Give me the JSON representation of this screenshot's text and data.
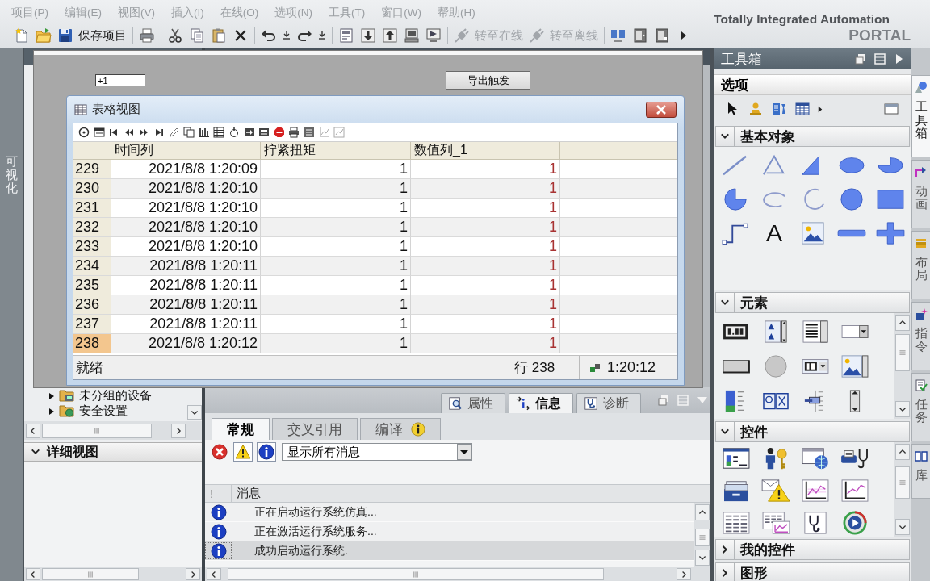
{
  "menu_bar": {
    "items": [
      {
        "label": "项目(P)",
        "disabled": true
      },
      {
        "label": "编辑(E)",
        "disabled": true
      },
      {
        "label": "视图(V)",
        "disabled": true
      },
      {
        "label": "插入(I)",
        "disabled": true
      },
      {
        "label": "在线(O)",
        "disabled": true
      },
      {
        "label": "选项(N)",
        "disabled": true
      },
      {
        "label": "工具(T)",
        "disabled": true
      },
      {
        "label": "窗口(W)",
        "disabled": true
      },
      {
        "label": "帮助(H)",
        "disabled": true
      }
    ]
  },
  "toolbar": {
    "buttons": [
      {
        "label": "保存项目",
        "disabled": false
      },
      {
        "label": "转至在线",
        "disabled": true
      },
      {
        "label": "转至离线",
        "disabled": true
      }
    ]
  },
  "branding": {
    "title": "Totally Integrated Automation",
    "product": "PORTAL"
  },
  "side_strip": {
    "label": "可视化"
  },
  "project_tree": {
    "items": [
      {
        "label": "未分组的设备",
        "expanded": false
      },
      {
        "label": "安全设置",
        "expanded": false
      }
    ],
    "detail_view": {
      "title": "详细视图",
      "expanded": true
    }
  },
  "runtime_screen": {
    "io_field": {
      "value": "+1"
    },
    "export_button": {
      "label": "导出触发"
    },
    "table_view": {
      "title": "表格视图",
      "columns": [
        "时间列",
        "拧紧扭矩",
        "数值列_1"
      ],
      "rows": [
        {
          "number": "229",
          "time": "2021/8/8 1:20:09",
          "torque": "1",
          "value": "1",
          "selected": false
        },
        {
          "number": "230",
          "time": "2021/8/8 1:20:10",
          "torque": "1",
          "value": "1",
          "selected": false
        },
        {
          "number": "231",
          "time": "2021/8/8 1:20:10",
          "torque": "1",
          "value": "1",
          "selected": false
        },
        {
          "number": "232",
          "time": "2021/8/8 1:20:10",
          "torque": "1",
          "value": "1",
          "selected": false
        },
        {
          "number": "233",
          "time": "2021/8/8 1:20:10",
          "torque": "1",
          "value": "1",
          "selected": false
        },
        {
          "number": "234",
          "time": "2021/8/8 1:20:11",
          "torque": "1",
          "value": "1",
          "selected": false
        },
        {
          "number": "235",
          "time": "2021/8/8 1:20:11",
          "torque": "1",
          "value": "1",
          "selected": false
        },
        {
          "number": "236",
          "time": "2021/8/8 1:20:11",
          "torque": "1",
          "value": "1",
          "selected": false
        },
        {
          "number": "237",
          "time": "2021/8/8 1:20:11",
          "torque": "1",
          "value": "1",
          "selected": false
        },
        {
          "number": "238",
          "time": "2021/8/8 1:20:12",
          "torque": "1",
          "value": "1",
          "selected": true
        }
      ],
      "status": "就绪",
      "row_indicator": "行 238",
      "time": "1:20:12"
    }
  },
  "inspector": {
    "tabs": [
      {
        "label": "属性",
        "selected": false
      },
      {
        "label": "信息",
        "selected": true
      },
      {
        "label": "诊断",
        "selected": false
      }
    ],
    "subtabs": [
      {
        "label": "常规",
        "selected": true
      },
      {
        "label": "交叉引用",
        "selected": false
      },
      {
        "label": "编译",
        "selected": false,
        "badge": {
          "kind": "info"
        }
      }
    ],
    "filters": [
      {
        "kind": "error",
        "on": false
      },
      {
        "kind": "warning",
        "on": true
      },
      {
        "kind": "info",
        "on": true
      }
    ],
    "filter_dropdown": {
      "value": "显示所有消息"
    },
    "columns": [
      "!",
      "消息"
    ],
    "messages": [
      {
        "kind": "info",
        "text": "正在启动运行系统仿真...",
        "selected": false
      },
      {
        "kind": "info",
        "text": "正在激活运行系统服务...",
        "selected": false
      },
      {
        "kind": "info",
        "text": "成功启动运行系统.",
        "selected": true
      }
    ]
  },
  "toolbox": {
    "title": "工具箱",
    "options": {
      "label": "选项"
    },
    "sections": [
      {
        "kind": "basic_objects",
        "label": "基本对象",
        "expanded": true,
        "text_glyph": "A"
      },
      {
        "kind": "elements",
        "label": "元素",
        "expanded": true
      },
      {
        "kind": "controls",
        "label": "控件",
        "expanded": true
      },
      {
        "kind": "my_controls",
        "label": "我的控件",
        "expanded": false
      },
      {
        "kind": "graphics",
        "label": "图形",
        "expanded": false
      }
    ]
  },
  "side_tabs": [
    {
      "label": "工具箱",
      "selected": true
    },
    {
      "label": "动画",
      "selected": false
    },
    {
      "label": "布局",
      "selected": false
    },
    {
      "label": "指令",
      "selected": false
    },
    {
      "label": "任务",
      "selected": false
    },
    {
      "label": "库",
      "selected": false
    }
  ]
}
